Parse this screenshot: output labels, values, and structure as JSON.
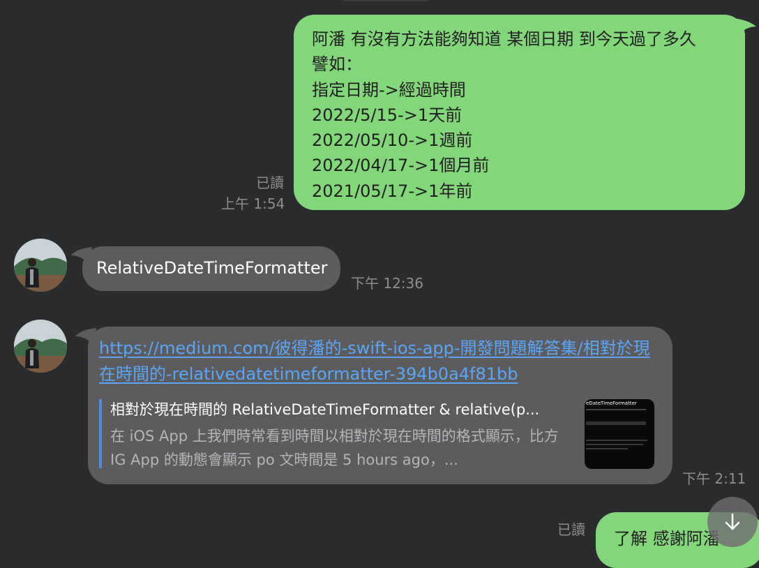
{
  "messages": {
    "outgoing_1": {
      "lines": "阿潘 有沒有方法能夠知道 某個日期 到今天過了多久\n譬如：\n指定日期->經過時間\n2022/5/15->1天前\n2022/05/10->1週前\n2022/04/17->1個月前\n2021/05/17->1年前",
      "read_label": "已讀",
      "time": "上午 1:54"
    },
    "incoming_1": {
      "text": "RelativeDateTimeFormatter",
      "time": "下午 12:36"
    },
    "incoming_2": {
      "link": "https://medium.com/彼得潘的-swift-ios-app-開發問題解答集/相對於現在時間的-relativedatetimeformatter-394b0a4f81bb",
      "preview_title": "相對於現在時間的 RelativeDateTimeFormatter & relative(p...",
      "preview_desc": "在 iOS App 上我們時常看到時間以相對於現在時間的格式顯示，比方 IG App 的動態會顯示 po 文時間是 5 hours ago，...",
      "thumbnail_title": "eDateTimeFormatter",
      "time": "下午 2:11"
    },
    "outgoing_2": {
      "text": "了解 感謝阿潘",
      "read_label": "已讀"
    }
  },
  "colors": {
    "background": "#2a2b2d",
    "outgoing_bubble": "#84d67a",
    "incoming_bubble": "#5c5c5e",
    "link": "#5aa6f5",
    "meta_text": "#8e8e90"
  },
  "icons": {
    "scroll_down": "arrow-down-icon",
    "avatar": "avatar"
  }
}
